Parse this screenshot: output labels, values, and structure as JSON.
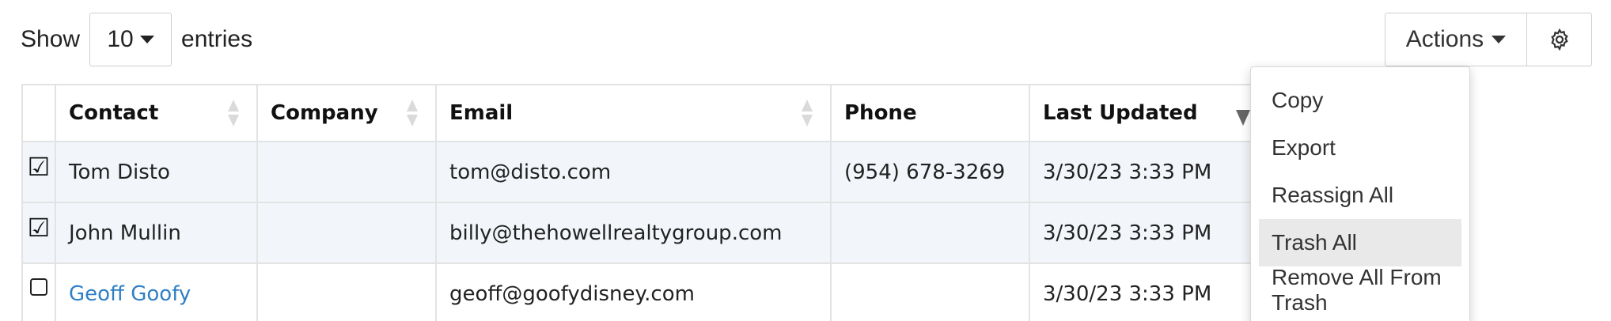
{
  "length_menu": {
    "prefix": "Show",
    "selected": "10",
    "suffix": "entries"
  },
  "toolbar": {
    "actions_label": "Actions",
    "settings_icon": "gear-icon"
  },
  "table": {
    "columns": [
      {
        "label": "",
        "sort": "none"
      },
      {
        "label": "Contact",
        "sort": "both"
      },
      {
        "label": "Company",
        "sort": "both"
      },
      {
        "label": "Email",
        "sort": "both"
      },
      {
        "label": "Phone",
        "sort": "none"
      },
      {
        "label": "Last Updated",
        "sort": "desc"
      }
    ],
    "rows": [
      {
        "checked": true,
        "contact": "Tom Disto",
        "contact_is_link": false,
        "company": "",
        "email": "tom@disto.com",
        "phone": "(954) 678-3269",
        "last_updated": "3/30/23 3:33 PM"
      },
      {
        "checked": true,
        "contact": "John Mullin",
        "contact_is_link": false,
        "company": "",
        "email": "billy@thehowellrealtygroup.com",
        "phone": "",
        "last_updated": "3/30/23 3:33 PM"
      },
      {
        "checked": false,
        "contact": "Geoff Goofy",
        "contact_is_link": true,
        "company": "",
        "email": "geoff@goofydisney.com",
        "phone": "",
        "last_updated": "3/30/23 3:33 PM"
      }
    ]
  },
  "actions_menu": {
    "items": [
      "Copy",
      "Export",
      "Reassign All",
      "Trash All",
      "Remove All From Trash"
    ],
    "highlighted": "Trash All"
  },
  "colors": {
    "link": "#2f7fc5",
    "selected_row": "#f2f6fa",
    "menu_hover": "#e9e9e9",
    "border": "#e3e3e3"
  }
}
